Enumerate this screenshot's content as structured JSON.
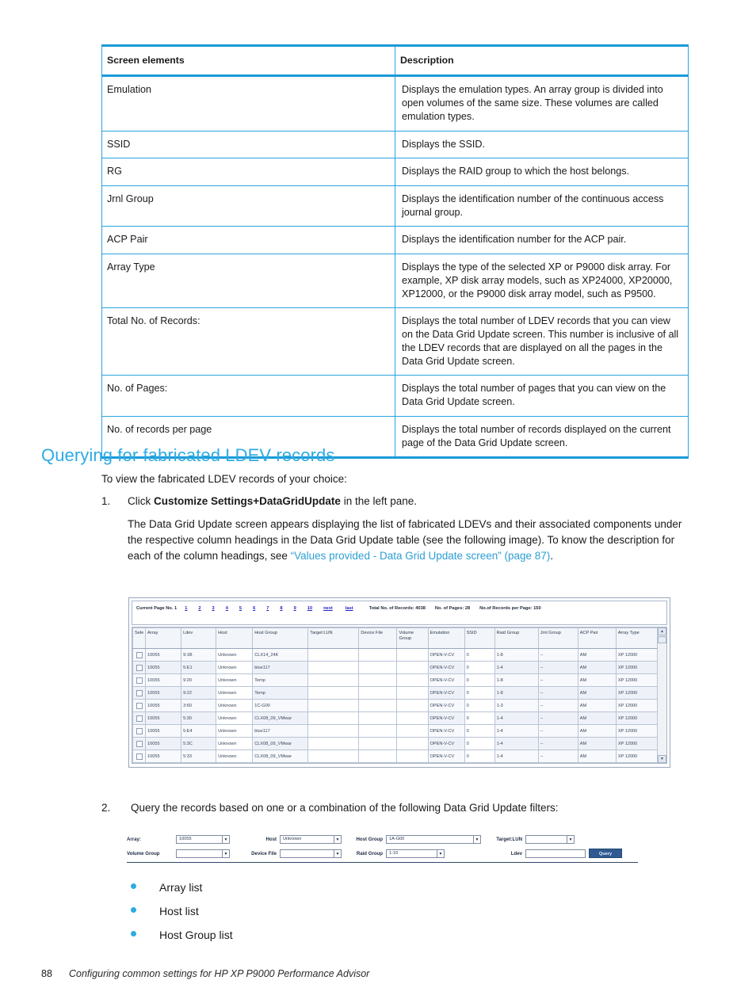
{
  "reference_table": {
    "headers": [
      "Screen elements",
      "Description"
    ],
    "rows": [
      {
        "element": "Emulation",
        "description": "Displays the emulation types. An array group is divided into open volumes of the same size. These volumes are called emulation types."
      },
      {
        "element": "SSID",
        "description": "Displays the SSID."
      },
      {
        "element": "RG",
        "description": "Displays the RAID group to which the host belongs."
      },
      {
        "element": "Jrnl Group",
        "description": "Displays the identification number of the continuous access journal group."
      },
      {
        "element": "ACP Pair",
        "description": "Displays the identification number for the ACP pair."
      },
      {
        "element": "Array Type",
        "description": "Displays the type of the selected XP or P9000 disk array. For example, XP disk array models, such as XP24000, XP20000, XP12000, or the P9000 disk array model, such as P9500."
      },
      {
        "element": "Total No. of Records:",
        "description": "Displays the total number of LDEV records that you can view on the Data Grid Update screen. This number is inclusive of all the LDEV records that are displayed on all the pages in the Data Grid Update screen."
      },
      {
        "element": "No. of Pages:",
        "description": "Displays the total number of pages that you can view on the Data Grid Update screen."
      },
      {
        "element": "No. of records per page",
        "description": "Displays the total number of records displayed on the current page of the Data Grid Update screen."
      }
    ]
  },
  "section": {
    "heading": "Querying for fabricated LDEV records",
    "intro": "To view the fabricated LDEV records of your choice:",
    "step1": {
      "number": "1.",
      "lead": "Click ",
      "bold1": "Customize Settings",
      "plus": "+",
      "bold2": "DataGridUpdate",
      "tail": " in the left pane.",
      "paragraph": "The Data Grid Update screen appears displaying the list of fabricated LDEVs and their associated components under the respective column headings in the Data Grid Update table (see the following image). To know the description for each of the column headings, see ",
      "xref": "“Values provided - Data Grid Update screen” (page 87)",
      "period": "."
    },
    "step2": {
      "number": "2.",
      "text": "Query the records based on one or a combination of the following Data Grid Update filters:"
    },
    "bullets": [
      "Array list",
      "Host list",
      "Host Group list"
    ]
  },
  "screenshot_grid": {
    "pager": {
      "current_label": "Current Page No. 1",
      "page_links": [
        "1",
        "2",
        "3",
        "4",
        "5",
        "6",
        "7",
        "8",
        "9",
        "10"
      ],
      "next_label": "next",
      "last_label": "last",
      "total_records": "Total No. of Records: 4038",
      "no_of_pages": "No. of Pages: 28",
      "records_per_page": "No.of Records per Page: 150"
    },
    "columns": [
      "Sele",
      "Array",
      "Ldev",
      "Host",
      "Host Group",
      "Target:LUN",
      "Device File",
      "Volume Group",
      "Emulation",
      "SSID",
      "Raid Group",
      "Jrnl Group",
      "ACP Pair",
      "Array Type"
    ],
    "rows": [
      {
        "array": "10055",
        "ldev": "9:1B",
        "host": "Unknown",
        "host_group": "CLX14_24K",
        "target_lun": "",
        "device_file": "",
        "volume_group": "",
        "emulation": "OPEN-V-CV",
        "ssid": "0",
        "raid_group": "1-8",
        "jrnl_group": "--",
        "acp_pair": "AM",
        "array_type": "XP 12000"
      },
      {
        "array": "10055",
        "ldev": "5:E1",
        "host": "Unknown",
        "host_group": "blue117",
        "target_lun": "",
        "device_file": "",
        "volume_group": "",
        "emulation": "OPEN-V-CV",
        "ssid": "0",
        "raid_group": "1-4",
        "jrnl_group": "--",
        "acp_pair": "AM",
        "array_type": "XP 12000"
      },
      {
        "array": "10055",
        "ldev": "9:20",
        "host": "Unknown",
        "host_group": "Temp",
        "target_lun": "",
        "device_file": "",
        "volume_group": "",
        "emulation": "OPEN-V-CV",
        "ssid": "0",
        "raid_group": "1-8",
        "jrnl_group": "--",
        "acp_pair": "AM",
        "array_type": "XP 12000"
      },
      {
        "array": "10055",
        "ldev": "9:22",
        "host": "Unknown",
        "host_group": "Temp",
        "target_lun": "",
        "device_file": "",
        "volume_group": "",
        "emulation": "OPEN-V-CV",
        "ssid": "0",
        "raid_group": "1-8",
        "jrnl_group": "--",
        "acp_pair": "AM",
        "array_type": "XP 12000"
      },
      {
        "array": "10055",
        "ldev": "3:60",
        "host": "Unknown",
        "host_group": "1C-G00",
        "target_lun": "",
        "device_file": "",
        "volume_group": "",
        "emulation": "OPEN-V-CV",
        "ssid": "0",
        "raid_group": "1-3",
        "jrnl_group": "--",
        "acp_pair": "AM",
        "array_type": "XP 12000"
      },
      {
        "array": "10055",
        "ldev": "5:30",
        "host": "Unknown",
        "host_group": "CLX08_09_VMwar",
        "target_lun": "",
        "device_file": "",
        "volume_group": "",
        "emulation": "OPEN-V-CV",
        "ssid": "0",
        "raid_group": "1-4",
        "jrnl_group": "--",
        "acp_pair": "AM",
        "array_type": "XP 12000"
      },
      {
        "array": "10055",
        "ldev": "5:E4",
        "host": "Unknown",
        "host_group": "blue117",
        "target_lun": "",
        "device_file": "",
        "volume_group": "",
        "emulation": "OPEN-V-CV",
        "ssid": "0",
        "raid_group": "1-4",
        "jrnl_group": "--",
        "acp_pair": "AM",
        "array_type": "XP 12000"
      },
      {
        "array": "10055",
        "ldev": "5:3C",
        "host": "Unknown",
        "host_group": "CLX08_09_VMwar",
        "target_lun": "",
        "device_file": "",
        "volume_group": "",
        "emulation": "OPEN-V-CV",
        "ssid": "0",
        "raid_group": "1-4",
        "jrnl_group": "--",
        "acp_pair": "AM",
        "array_type": "XP 12000"
      },
      {
        "array": "10055",
        "ldev": "5:33",
        "host": "Unknown",
        "host_group": "CLX08_09_VMwar",
        "target_lun": "",
        "device_file": "",
        "volume_group": "",
        "emulation": "OPEN-V-CV",
        "ssid": "0",
        "raid_group": "1-4",
        "jrnl_group": "--",
        "acp_pair": "AM",
        "array_type": "XP 12000"
      }
    ]
  },
  "screenshot_filters": {
    "array_label": "Array:",
    "array_value": "10055",
    "host_label": "Host",
    "host_value": "Unknown",
    "host_group_label": "Host Group",
    "host_group_value": "1A-G00",
    "target_lun_label": "Target:LUN",
    "target_lun_value": "",
    "volume_group_label": "Volume Group",
    "volume_group_value": "",
    "device_file_label": "Device File",
    "device_file_value": "",
    "raid_group_label": "Raid Group",
    "raid_group_value": "1-10",
    "ldev_label": "Ldev",
    "ldev_value": "",
    "query_button": "Query"
  },
  "footer": {
    "page_number": "88",
    "text": "Configuring common settings for HP XP P9000 Performance Advisor"
  },
  "colors": {
    "accent_blue": "#2eabe2",
    "table_border": "#29a3dc",
    "link_blue": "#2323c8",
    "button_blue": "#2f5b92"
  }
}
